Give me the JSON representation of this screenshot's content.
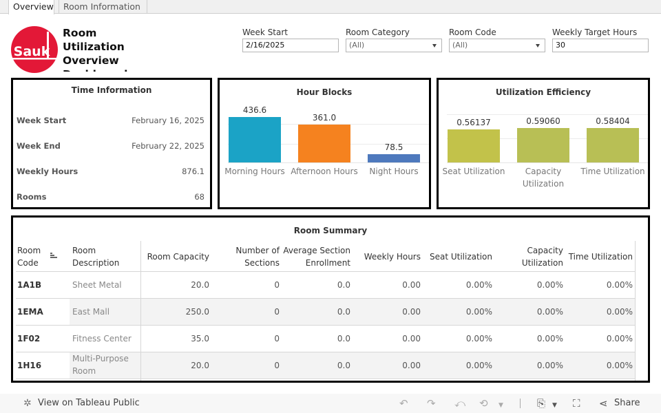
{
  "tabs": [
    {
      "label": "Overview",
      "active": true
    },
    {
      "label": "Room Information",
      "active": false
    }
  ],
  "header": {
    "logo_text": "Sauk",
    "logo_color": "#e31837",
    "title": "Room Utilization Overview Dashboard"
  },
  "filters": {
    "week_start": {
      "label": "Week Start",
      "value": "2/16/2025"
    },
    "room_category": {
      "label": "Room Category",
      "value": "(All)"
    },
    "room_code": {
      "label": "Room Code",
      "value": "(All)"
    },
    "weekly_target_hours": {
      "label": "Weekly Target Hours",
      "value": "30"
    }
  },
  "time_information": {
    "title": "Time Information",
    "rows": [
      {
        "label": "Week Start",
        "value": "February 16, 2025"
      },
      {
        "label": "Week End",
        "value": "February 22, 2025"
      },
      {
        "label": "Weekly Hours",
        "value": "876.1"
      },
      {
        "label": "Rooms",
        "value": "68"
      }
    ]
  },
  "chart_data": [
    {
      "type": "bar",
      "title": "Hour Blocks",
      "categories": [
        "Morning Hours",
        "Afternoon Hours",
        "Night Hours"
      ],
      "values": [
        436.6,
        361.0,
        78.5
      ],
      "labels": [
        "436.6",
        "361.0",
        "78.5"
      ],
      "colors": [
        "#1ba3c6",
        "#f5821f",
        "#4e79bd"
      ],
      "xlabel": "",
      "ylabel": "",
      "ylim": [
        0,
        500
      ],
      "grid": true
    },
    {
      "type": "bar",
      "title": "Utilization Efficiency",
      "categories": [
        "Seat Utilization",
        "Capacity Utilization",
        "Time Utilization"
      ],
      "values": [
        0.56137,
        0.5906,
        0.58404
      ],
      "labels": [
        "0.56137",
        "0.59060",
        "0.58404"
      ],
      "colors": [
        "#c2c24a",
        "#b8bf55",
        "#b8bf55"
      ],
      "xlabel": "",
      "ylabel": "",
      "ylim": [
        0,
        0.8
      ],
      "grid": true
    }
  ],
  "room_summary": {
    "title": "Room Summary",
    "columns": [
      "Room Code",
      "Room Description",
      "Room Capacity",
      "Number of Sections",
      "Average Section Enrollment",
      "Weekly Hours",
      "Seat Utilization",
      "Capacity Utilization",
      "Time Utilization"
    ],
    "sort_icon": "sort-descending-icon",
    "rows": [
      {
        "code": "1A1B",
        "description": "Sheet Metal",
        "capacity": "20.0",
        "sections": "0",
        "avg_enrollment": "0.0",
        "weekly_hours": "0.00",
        "seat_util": "0.00%",
        "capacity_util": "0.00%",
        "time_util": "0.00%"
      },
      {
        "code": "1EMA",
        "description": "East Mall",
        "capacity": "250.0",
        "sections": "0",
        "avg_enrollment": "0.0",
        "weekly_hours": "0.00",
        "seat_util": "0.00%",
        "capacity_util": "0.00%",
        "time_util": "0.00%"
      },
      {
        "code": "1F02",
        "description": "Fitness Center",
        "capacity": "35.0",
        "sections": "0",
        "avg_enrollment": "0.0",
        "weekly_hours": "0.00",
        "seat_util": "0.00%",
        "capacity_util": "0.00%",
        "time_util": "0.00%"
      },
      {
        "code": "1H16",
        "description": "Multi-Purpose Room",
        "capacity": "20.0",
        "sections": "0",
        "avg_enrollment": "0.0",
        "weekly_hours": "0.00",
        "seat_util": "0.00%",
        "capacity_util": "0.00%",
        "time_util": "0.00%"
      }
    ]
  },
  "footer": {
    "view_on_public": "View on Tableau Public",
    "share": "Share",
    "icons": [
      "tableau-icon",
      "undo-icon",
      "redo-icon",
      "revert-icon",
      "refresh-icon",
      "download-icon",
      "fullscreen-icon",
      "share-icon"
    ]
  }
}
